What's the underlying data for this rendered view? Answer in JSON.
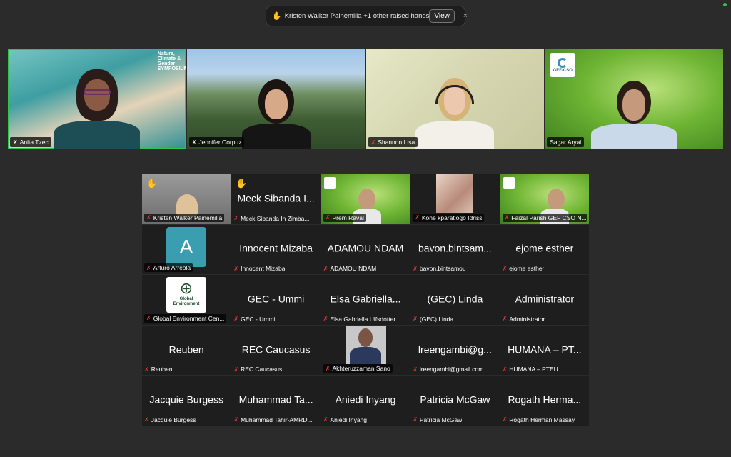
{
  "notification": {
    "text": "Kristen Walker Painemilla +1 other raised hands",
    "view_label": "View",
    "close_label": "×"
  },
  "top_videos": [
    {
      "name": "Anita Tzec",
      "logo": "Nature, Climate & Gender SYMPOSIUM"
    },
    {
      "name": "Jennifer Corpuz"
    },
    {
      "name": "Shannon Lisa"
    },
    {
      "name": "Sagar Aryal",
      "logo": "GEF-CSO"
    }
  ],
  "gallery": [
    {
      "display": "",
      "label": "Kristen Walker Painemilla",
      "hand": true,
      "video": "kristen"
    },
    {
      "display": "Meck Sibanda I...",
      "label": "Meck Sibanda In Zimba...",
      "hand": true
    },
    {
      "display": "",
      "label": "Prem Raval",
      "video": "prem"
    },
    {
      "display": "",
      "label": "Koné kparatiogo Idriss",
      "video": "kone"
    },
    {
      "display": "",
      "label": "Faizal Parish GEF CSO N...",
      "video": "faizal"
    },
    {
      "display": "",
      "label": "Arturo Arreola",
      "avatar": "A"
    },
    {
      "display": "Innocent Mizaba",
      "label": "Innocent Mizaba"
    },
    {
      "display": "ADAMOU NDAM",
      "label": "ADAMOU NDAM"
    },
    {
      "display": "bavon.bintsam...",
      "label": "bavon.bintsamou"
    },
    {
      "display": "ejome esther",
      "label": "ejome esther"
    },
    {
      "display": "",
      "label": "Global Environment Cen...",
      "gec": "Global Environment"
    },
    {
      "display": "GEC - Ummi",
      "label": "GEC - Ummi"
    },
    {
      "display": "Elsa Gabriella...",
      "label": "Elsa Gabriella Ulfsdotter..."
    },
    {
      "display": "(GEC) Linda",
      "label": "(GEC) Linda"
    },
    {
      "display": "Administrator",
      "label": "Administrator"
    },
    {
      "display": "Reuben",
      "label": "Reuben"
    },
    {
      "display": "REC Caucasus",
      "label": "REC Caucasus"
    },
    {
      "display": "",
      "label": "Akhteruzzaman Sano",
      "video": "akhter"
    },
    {
      "display": "lreengambi@g...",
      "label": "lreengambi@gmail.com"
    },
    {
      "display": "HUMANA – PT...",
      "label": "HUMANA – PTEU"
    },
    {
      "display": "Jacquie Burgess",
      "label": "Jacquie Burgess"
    },
    {
      "display": "Muhammad Ta...",
      "label": "Muhammad Tahir-AMRD..."
    },
    {
      "display": "Aniedi Inyang",
      "label": "Aniedi Inyang"
    },
    {
      "display": "Patricia McGaw",
      "label": "Patricia McGaw"
    },
    {
      "display": "Rogath Herma...",
      "label": "Rogath Herman Massay"
    }
  ]
}
